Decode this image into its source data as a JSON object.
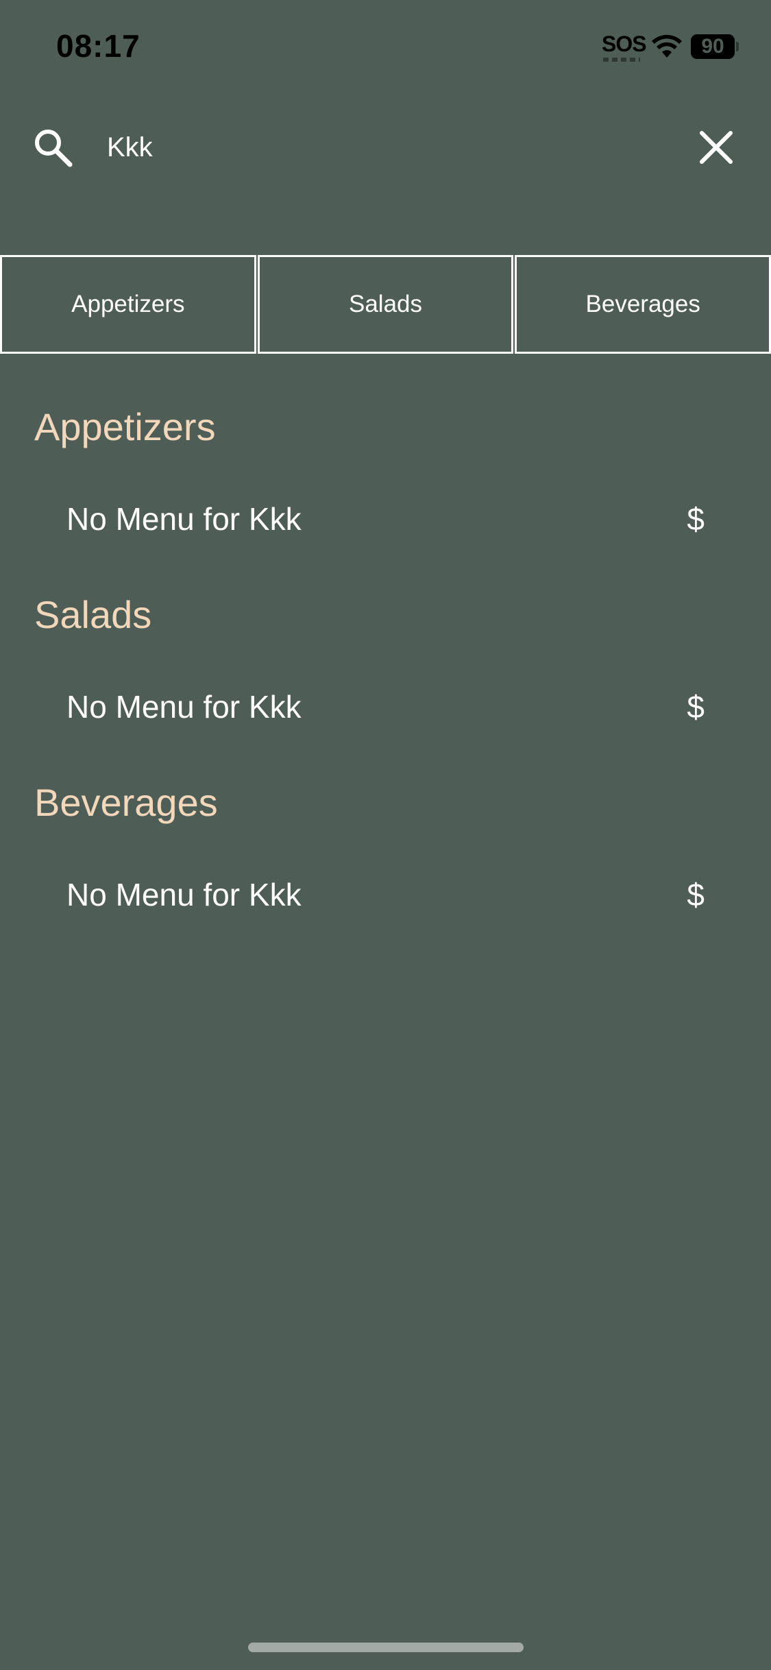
{
  "status_bar": {
    "time": "08:17",
    "sos": "SOS",
    "battery": "90",
    "icons": [
      "wifi-icon",
      "battery-icon"
    ]
  },
  "search": {
    "value": "Kkk",
    "placeholder": "",
    "icons": [
      "search-icon",
      "close-icon"
    ]
  },
  "tabs": [
    {
      "label": "Appetizers"
    },
    {
      "label": "Salads"
    },
    {
      "label": "Beverages"
    }
  ],
  "sections": [
    {
      "title": "Appetizers",
      "item": {
        "name": "No Menu for Kkk",
        "price": "$"
      }
    },
    {
      "title": "Salads",
      "item": {
        "name": "No Menu for Kkk",
        "price": "$"
      }
    },
    {
      "title": "Beverages",
      "item": {
        "name": "No Menu for Kkk",
        "price": "$"
      }
    }
  ],
  "colors": {
    "background": "#4e5e57",
    "section_title": "#f3d7bb",
    "text": "#ffffff"
  }
}
